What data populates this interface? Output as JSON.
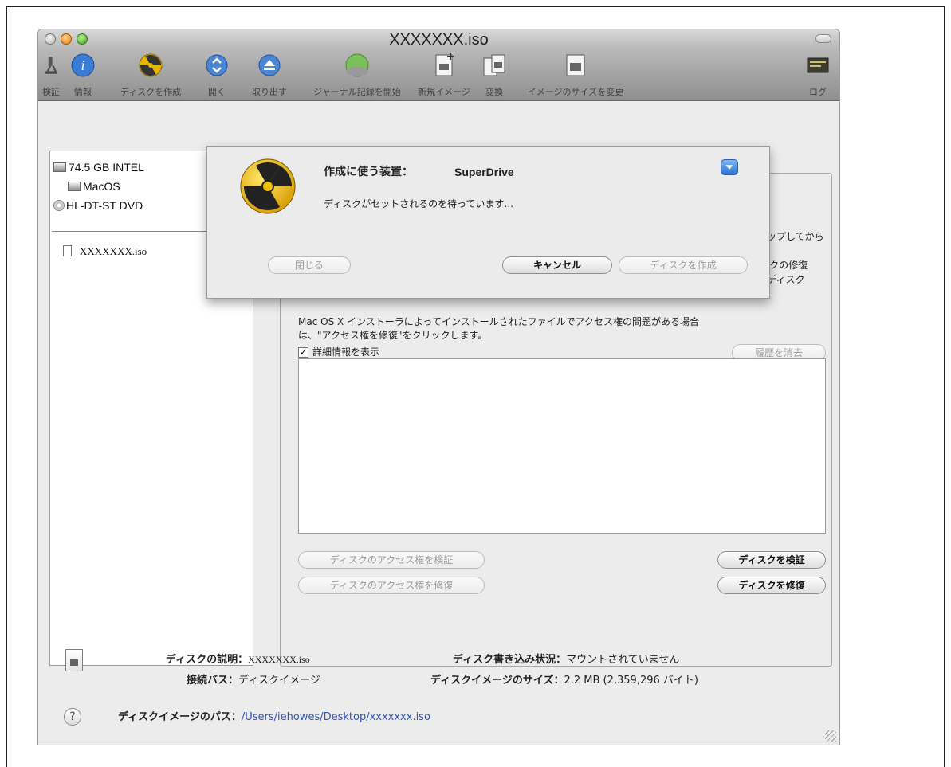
{
  "window": {
    "title": "XXXXXXX.iso"
  },
  "toolbar": {
    "items": [
      {
        "label": "検証",
        "icon": "microscope-icon"
      },
      {
        "label": "情報",
        "icon": "info-icon"
      },
      {
        "label": "ディスクを作成",
        "icon": "burn-icon"
      },
      {
        "label": "開く",
        "icon": "mount-icon"
      },
      {
        "label": "取り出す",
        "icon": "eject-icon"
      },
      {
        "label": "ジャーナル記録を開始",
        "icon": "journal-icon"
      },
      {
        "label": "新規イメージ",
        "icon": "new-image-icon"
      },
      {
        "label": "変換",
        "icon": "convert-icon"
      },
      {
        "label": "イメージのサイズを変更",
        "icon": "resize-image-icon"
      },
      {
        "label": "ログ",
        "icon": "log-icon"
      }
    ]
  },
  "sidebar": {
    "items": [
      {
        "label": "74.5 GB INTEL"
      },
      {
        "label": "MacOS"
      },
      {
        "label": "HL-DT-ST DVD"
      },
      {
        "label": "XXXXXXX.iso"
      }
    ]
  },
  "sheet": {
    "device_label": "作成に使う装置：",
    "device_value": "SuperDrive",
    "status": "ディスクがセットされるのを待っています...",
    "close_button": "閉じる",
    "cancel_button": "キャンセル",
    "burn_button": "ディスクを作成"
  },
  "main": {
    "partial_right_1": "ックアップしてから",
    "partial_right_2": "。ディスクの修復",
    "partial_right_3": "ティ\">\"ディスク",
    "permission_text_1": "Mac OS X インストーラによってインストールされたファイルでアクセス権の問題がある場合",
    "permission_text_2": "は、\"アクセス権を修復\"をクリックします。",
    "show_details_label": "詳細情報を表示",
    "clear_history_button": "履歴を消去",
    "verify_permissions_button": "ディスクのアクセス権を検証",
    "repair_permissions_button": "ディスクのアクセス権を修復",
    "verify_disk_button": "ディスクを検証",
    "repair_disk_button": "ディスクを修復"
  },
  "info": {
    "description_label": "ディスクの説明：",
    "description_value": "XXXXXXX.iso",
    "connection_label": "接続バス：",
    "connection_value": "ディスクイメージ",
    "write_status_label": "ディスク書き込み状況：",
    "write_status_value": "マウントされていません",
    "image_size_label": "ディスクイメージのサイズ：",
    "image_size_value": "2.2 MB (2,359,296 バイト)",
    "path_label": "ディスクイメージのパス：",
    "path_value": "/Users/iehowes/Desktop/xxxxxxx.iso"
  },
  "colors": {
    "toolbar": "#9c9c9c",
    "link": "#2f55b5",
    "window_bg": "#ececec"
  }
}
